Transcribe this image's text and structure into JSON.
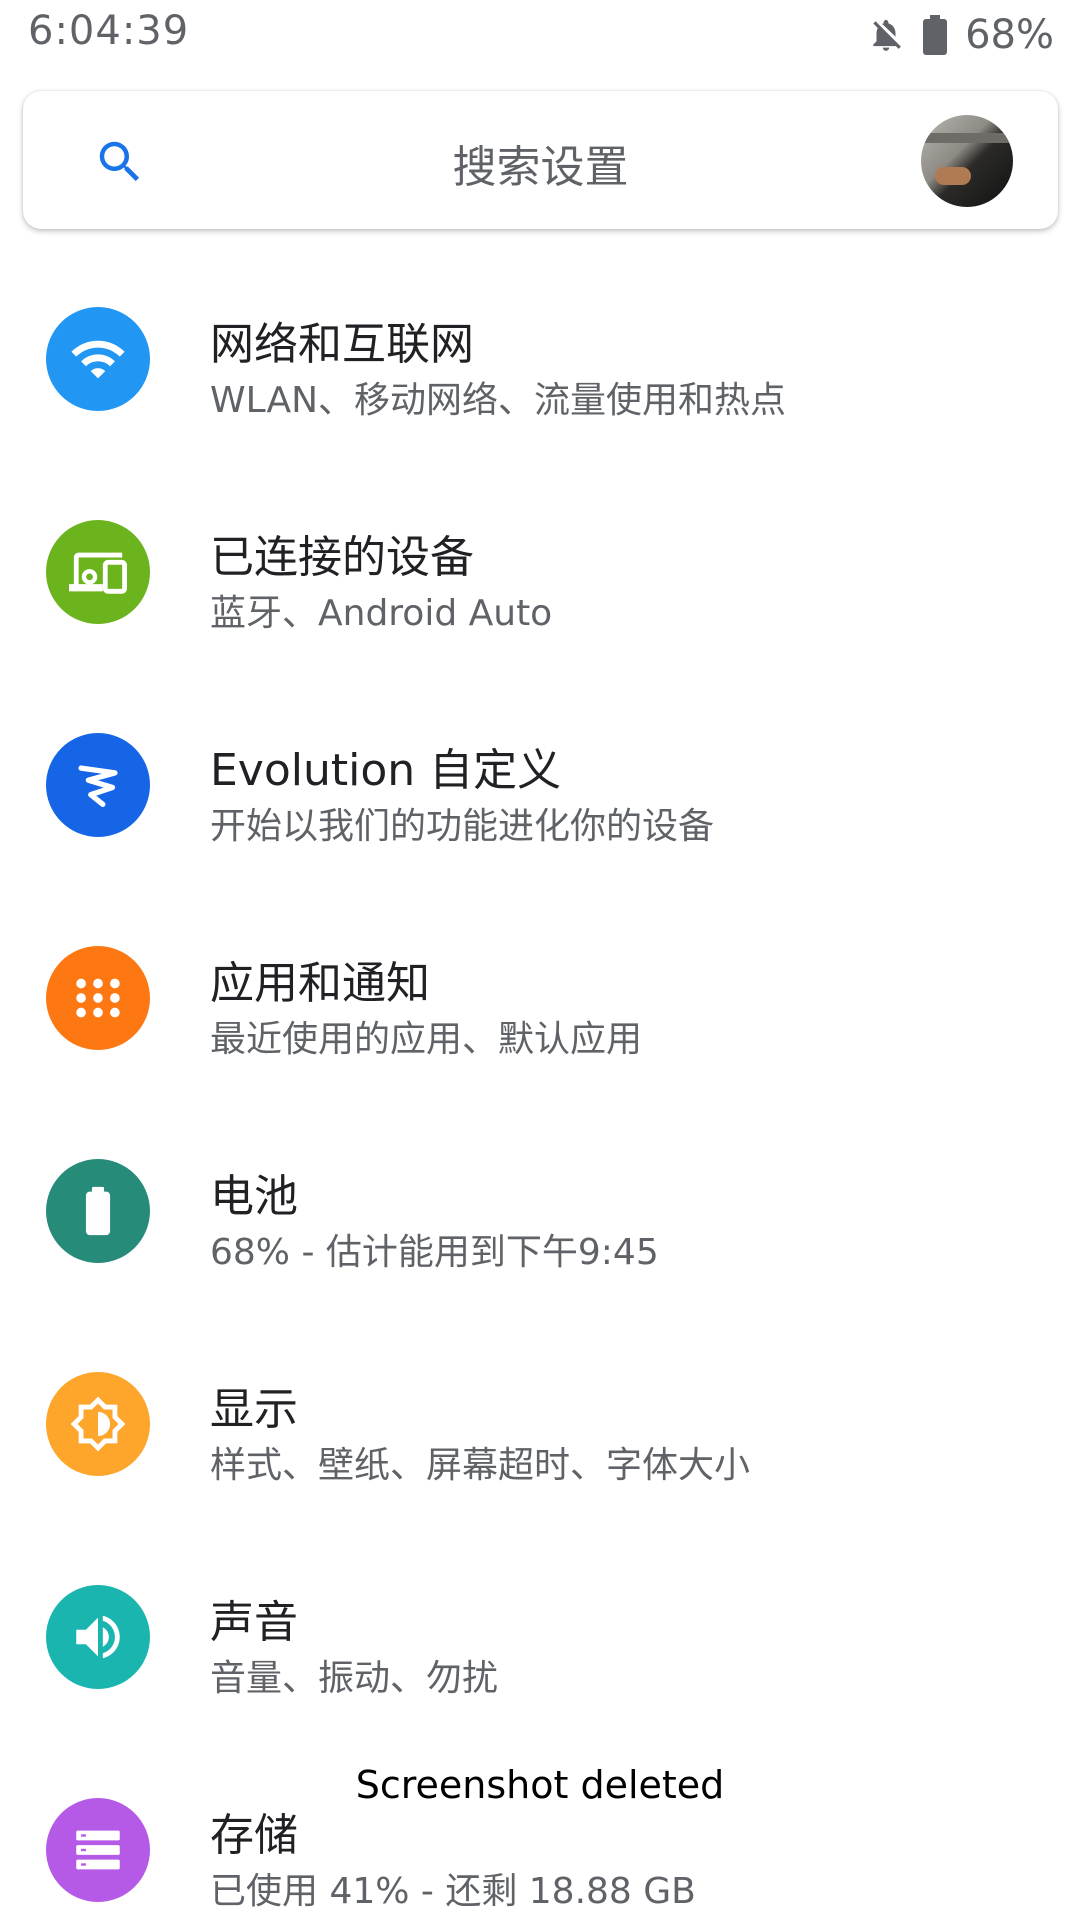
{
  "status_bar": {
    "time": "6:04:39",
    "battery": "68%",
    "icons": [
      "notifications-off-icon",
      "battery-icon"
    ]
  },
  "search": {
    "placeholder": "搜索设置"
  },
  "colors": {
    "network": "#2196f3",
    "connected": "#6cb41e",
    "evolution": "#1565e6",
    "apps": "#fd7712",
    "battery": "#278b7a",
    "display": "#fea52c",
    "sound": "#1bb5b0",
    "storage": "#b45ae6"
  },
  "settings": [
    {
      "icon": "wifi-icon",
      "title": "网络和互联网",
      "subtitle": "WLAN、移动网络、流量使用和热点"
    },
    {
      "icon": "devices-icon",
      "title": "已连接的设备",
      "subtitle": "蓝牙、Android Auto"
    },
    {
      "icon": "evolution-logo-icon",
      "title": "Evolution 自定义",
      "subtitle": "开始以我们的功能进化你的设备"
    },
    {
      "icon": "apps-grid-icon",
      "title": "应用和通知",
      "subtitle": "最近使用的应用、默认应用"
    },
    {
      "icon": "battery-icon",
      "title": "电池",
      "subtitle": "68% - 估计能用到下午9:45"
    },
    {
      "icon": "brightness-icon",
      "title": "显示",
      "subtitle": "样式、壁纸、屏幕超时、字体大小"
    },
    {
      "icon": "volume-icon",
      "title": "声音",
      "subtitle": "音量、振动、勿扰"
    },
    {
      "icon": "storage-icon",
      "title": "存储",
      "subtitle": "已使用 41% - 还剩 18.88 GB"
    }
  ],
  "toast": {
    "message": "Screenshot deleted"
  }
}
